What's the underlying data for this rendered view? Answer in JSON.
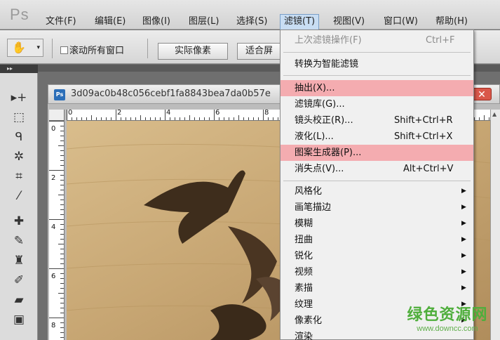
{
  "app": {
    "logo": "Ps"
  },
  "menubar": {
    "items": [
      {
        "label": "文件(F)"
      },
      {
        "label": "编辑(E)"
      },
      {
        "label": "图像(I)"
      },
      {
        "label": "图层(L)"
      },
      {
        "label": "选择(S)"
      },
      {
        "label": "滤镜(T)",
        "active": true
      },
      {
        "label": "视图(V)"
      },
      {
        "label": "窗口(W)"
      },
      {
        "label": "帮助(H)"
      }
    ]
  },
  "options_bar": {
    "tool_icon": "hand-icon",
    "dropdown_arrow": "▾",
    "scroll_all_label": "滚动所有窗口",
    "scroll_all_checked": false,
    "actual_pixels_label": "实际像素",
    "fit_screen_label": "适合屏"
  },
  "toolbar": {
    "collapse_glyph": "▸▸",
    "tools": [
      {
        "name": "move-tool-icon",
        "glyph": "▸+"
      },
      {
        "name": "marquee-tool-icon",
        "glyph": "⬚"
      },
      {
        "name": "lasso-tool-icon",
        "glyph": "ᑫ"
      },
      {
        "name": "magic-wand-tool-icon",
        "glyph": "✲"
      },
      {
        "name": "crop-tool-icon",
        "glyph": "⌗"
      },
      {
        "name": "eyedropper-tool-icon",
        "glyph": "⁄"
      },
      {
        "name": "healing-brush-tool-icon",
        "glyph": "✚"
      },
      {
        "name": "brush-tool-icon",
        "glyph": "✎"
      },
      {
        "name": "stamp-tool-icon",
        "glyph": "♜"
      },
      {
        "name": "history-brush-tool-icon",
        "glyph": "✐"
      },
      {
        "name": "eraser-tool-icon",
        "glyph": "▰"
      },
      {
        "name": "gradient-tool-icon",
        "glyph": "▣"
      }
    ]
  },
  "document": {
    "icon_label": "Ps",
    "title": "3d09ac0b48c056cebf1fa8843bea7da0b57e",
    "ruler_h_labels": [
      "0",
      "2",
      "4",
      "6",
      "8"
    ],
    "ruler_v_labels": [
      "0",
      "2",
      "4",
      "6",
      "8"
    ],
    "close_glyph": "✕",
    "scroll_up_glyph": "▲"
  },
  "filter_menu": {
    "items": [
      {
        "label": "上次滤镜操作(F)",
        "shortcut": "Ctrl+F",
        "disabled": true
      },
      {
        "separator": true
      },
      {
        "label": "转换为智能滤镜"
      },
      {
        "separator": true
      },
      {
        "label": "抽出(X)...",
        "highlighted": true
      },
      {
        "label": "滤镜库(G)..."
      },
      {
        "label": "镜头校正(R)...",
        "shortcut": "Shift+Ctrl+R"
      },
      {
        "label": "液化(L)...",
        "shortcut": "Shift+Ctrl+X"
      },
      {
        "label": "图案生成器(P)...",
        "highlighted": true
      },
      {
        "label": "消失点(V)...",
        "shortcut": "Alt+Ctrl+V"
      },
      {
        "separator": true
      },
      {
        "label": "风格化",
        "submenu": true
      },
      {
        "label": "画笔描边",
        "submenu": true
      },
      {
        "label": "模糊",
        "submenu": true
      },
      {
        "label": "扭曲",
        "submenu": true
      },
      {
        "label": "锐化",
        "submenu": true
      },
      {
        "label": "视频",
        "submenu": true
      },
      {
        "label": "素描",
        "submenu": true
      },
      {
        "label": "纹理",
        "submenu": true
      },
      {
        "label": "像素化",
        "submenu": true
      },
      {
        "label": "渲染",
        "submenu": true
      }
    ],
    "submenu_arrow": "▶"
  },
  "watermark": {
    "main": "绿色资源网",
    "url": "www.downcc.com"
  },
  "colors": {
    "menu_highlight": "#f4acb0",
    "active_menu": "#c8ddf3",
    "watermark": "#4fae3c",
    "wood": "#c9a876"
  }
}
